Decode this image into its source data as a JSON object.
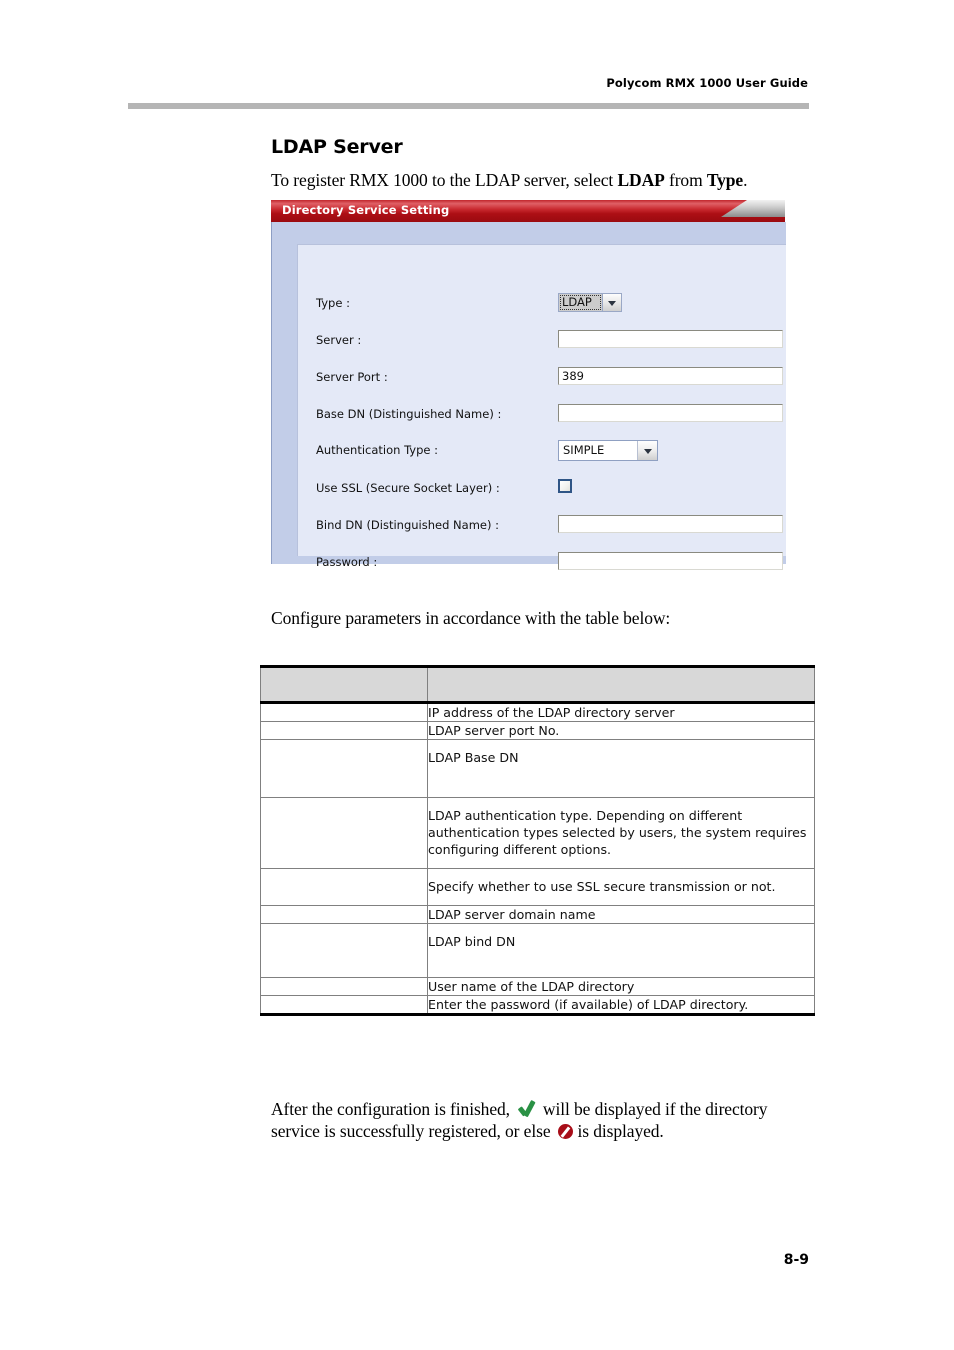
{
  "header": {
    "running_head": "Polycom RMX 1000 User Guide"
  },
  "section": {
    "title": "LDAP Server",
    "intro_prefix": "To register RMX 1000 to the LDAP server, select ",
    "intro_bold_1": "LDAP",
    "intro_middle": " from ",
    "intro_bold_2": "Type",
    "intro_suffix": ".",
    "configure_line": "Configure parameters in accordance with the table below:"
  },
  "dialog": {
    "title": "Directory Service Setting",
    "fields": [
      {
        "label": "Type :",
        "type": "select",
        "value": "LDAP"
      },
      {
        "label": "Server :",
        "type": "text",
        "value": ""
      },
      {
        "label": "Server Port :",
        "type": "text",
        "value": "389"
      },
      {
        "label": "Base DN (Distinguished Name) :",
        "type": "text",
        "value": ""
      },
      {
        "label": "Authentication Type :",
        "type": "select",
        "value": "SIMPLE"
      },
      {
        "label": "Use SSL (Secure Socket Layer) :",
        "type": "checkbox",
        "value": ""
      },
      {
        "label": "Bind DN (Distinguished Name) :",
        "type": "text",
        "value": ""
      },
      {
        "label": "Password :",
        "type": "text",
        "value": ""
      }
    ]
  },
  "table": {
    "headers": [
      "",
      ""
    ],
    "rows": [
      {
        "name": "",
        "desc": "IP address of the LDAP directory server"
      },
      {
        "name": "",
        "desc": "LDAP server port No."
      },
      {
        "name": "",
        "desc": "LDAP Base DN"
      },
      {
        "name": "",
        "desc": "LDAP authentication type. Depending on different authentication types selected by users, the system requires configuring different options."
      },
      {
        "name": "",
        "desc": "Specify whether to use SSL secure transmission or not."
      },
      {
        "name": "",
        "desc": "LDAP server domain name"
      },
      {
        "name": "",
        "desc": "LDAP bind DN"
      },
      {
        "name": "",
        "desc": "User name of the LDAP directory"
      },
      {
        "name": "",
        "desc": "Enter the password (if available) of LDAP directory."
      }
    ]
  },
  "closing": {
    "part1": "After the configuration is finished,",
    "part2": "will be displayed if the directory",
    "part3": "service is successfully registered, or else",
    "part4": "is displayed."
  },
  "footer": {
    "page_number": "8-9"
  },
  "colors": {
    "titlebar_red": "#ad0f15",
    "dialog_body": "#c2cde8",
    "dialog_inner": "#e4e9f7",
    "header_rule": "#b5b5b5",
    "table_header": "#d8d8d8",
    "success_green": "#2a9145",
    "error_red": "#a80d18"
  }
}
